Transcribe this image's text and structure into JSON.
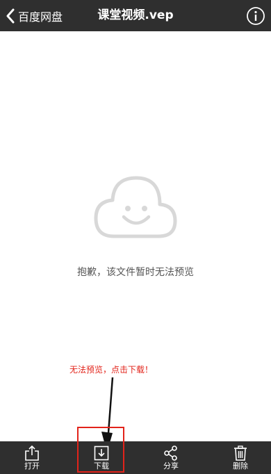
{
  "header": {
    "back_label": "百度网盘",
    "title": "课堂视频.vep"
  },
  "content": {
    "message": "抱歉，该文件暂时无法预览"
  },
  "annotation": {
    "text": "无法预览，点击下载！",
    "color": "#e2231a"
  },
  "toolbar": {
    "items": [
      {
        "label": "打开",
        "icon": "share-out-icon"
      },
      {
        "label": "下载",
        "icon": "download-icon"
      },
      {
        "label": "分享",
        "icon": "share-icon"
      },
      {
        "label": "删除",
        "icon": "trash-icon"
      }
    ]
  },
  "colors": {
    "bar_background": "#2f2f2f",
    "cloud": "#d8d8d8",
    "highlight": "#e2231a"
  }
}
